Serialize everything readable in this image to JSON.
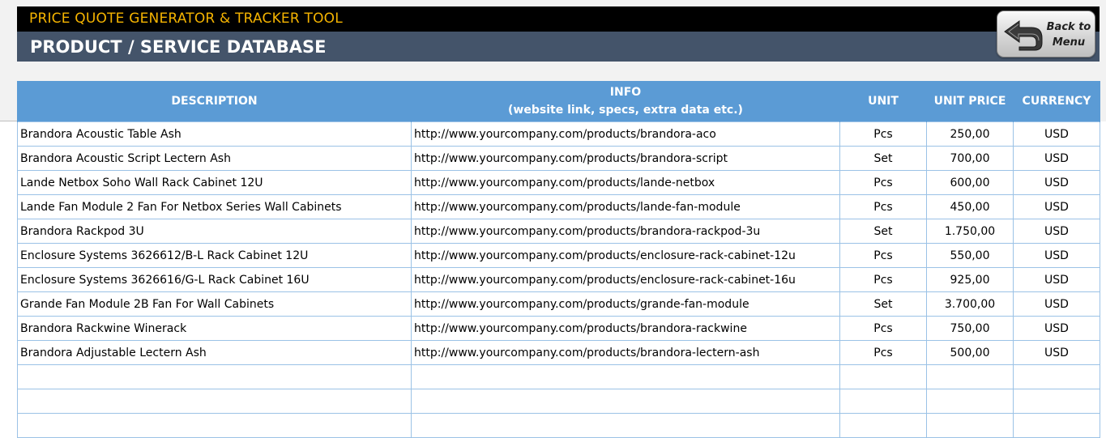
{
  "app": {
    "title": "PRICE QUOTE GENERATOR & TRACKER TOOL",
    "subtitle": "PRODUCT / SERVICE DATABASE",
    "back_button": {
      "line1": "Back to",
      "line2": "Menu",
      "icon": "back-arrow-icon"
    }
  },
  "colors": {
    "title_bg": "#000000",
    "title_text": "#f5b400",
    "subtitle_bg": "#44546a",
    "header_bg": "#5b9bd5",
    "grid": "#9bc2e6"
  },
  "table": {
    "headers": {
      "description": "DESCRIPTION",
      "info_line1": "INFO",
      "info_line2": "(website link, specs, extra data etc.)",
      "unit": "UNIT",
      "unit_price": "UNIT PRICE",
      "currency": "CURRENCY"
    },
    "rows": [
      {
        "description": "Brandora Acoustic Table Ash",
        "info": "http://www.yourcompany.com/products/brandora-aco",
        "unit": "Pcs",
        "price": "250,00",
        "currency": "USD"
      },
      {
        "description": "Brandora Acoustic Script Lectern Ash",
        "info": "http://www.yourcompany.com/products/brandora-script",
        "unit": "Set",
        "price": "700,00",
        "currency": "USD"
      },
      {
        "description": "Lande Netbox Soho Wall Rack Cabinet 12U",
        "info": "http://www.yourcompany.com/products/lande-netbox",
        "unit": "Pcs",
        "price": "600,00",
        "currency": "USD"
      },
      {
        "description": "Lande Fan Module 2 Fan For Netbox Series Wall Cabinets",
        "info": "http://www.yourcompany.com/products/lande-fan-module",
        "unit": "Pcs",
        "price": "450,00",
        "currency": "USD"
      },
      {
        "description": "Brandora Rackpod 3U",
        "info": "http://www.yourcompany.com/products/brandora-rackpod-3u",
        "unit": "Set",
        "price": "1.750,00",
        "currency": "USD"
      },
      {
        "description": "Enclosure Systems 3626612/B-L Rack Cabinet 12U",
        "info": "http://www.yourcompany.com/products/enclosure-rack-cabinet-12u",
        "unit": "Pcs",
        "price": "550,00",
        "currency": "USD"
      },
      {
        "description": "Enclosure Systems 3626616/G-L Rack Cabinet 16U",
        "info": "http://www.yourcompany.com/products/enclosure-rack-cabinet-16u",
        "unit": "Pcs",
        "price": "925,00",
        "currency": "USD"
      },
      {
        "description": "Grande Fan Module 2B Fan For Wall Cabinets",
        "info": "http://www.yourcompany.com/products/grande-fan-module",
        "unit": "Set",
        "price": "3.700,00",
        "currency": "USD"
      },
      {
        "description": "Brandora Rackwine Winerack",
        "info": "http://www.yourcompany.com/products/brandora-rackwine",
        "unit": "Pcs",
        "price": "750,00",
        "currency": "USD"
      },
      {
        "description": "Brandora Adjustable Lectern Ash",
        "info": "http://www.yourcompany.com/products/brandora-lectern-ash",
        "unit": "Pcs",
        "price": "500,00",
        "currency": "USD"
      }
    ],
    "empty_rows": 3
  }
}
